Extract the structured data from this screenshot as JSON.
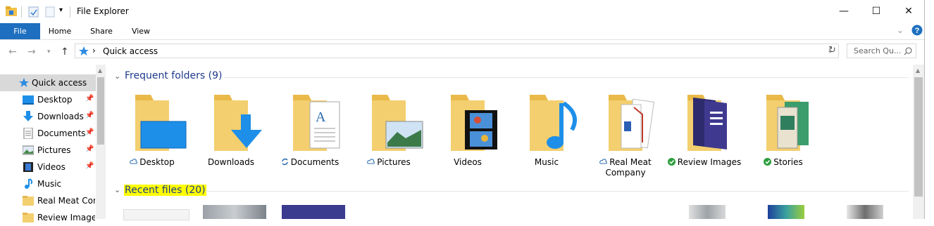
{
  "window": {
    "title": "File Explorer",
    "minimize": "—",
    "maximize": "☐",
    "close": "✕"
  },
  "ribbon": {
    "tabs": [
      "File",
      "Home",
      "Share",
      "View"
    ]
  },
  "address": {
    "location": "Quick access",
    "separator": "›",
    "search_placeholder": "Search Qu..."
  },
  "sidebar": {
    "items": [
      {
        "label": "Quick access",
        "pinned": false,
        "selected": true
      },
      {
        "label": "Desktop",
        "pinned": true
      },
      {
        "label": "Downloads",
        "pinned": true
      },
      {
        "label": "Documents",
        "pinned": true
      },
      {
        "label": "Pictures",
        "pinned": true
      },
      {
        "label": "Videos",
        "pinned": true
      },
      {
        "label": "Music",
        "pinned": false
      },
      {
        "label": "Real Meat Com",
        "pinned": false
      },
      {
        "label": "Review Images",
        "pinned": false
      }
    ]
  },
  "frequent": {
    "title": "Frequent folders (9)",
    "folders": [
      {
        "label": "Desktop",
        "status": "cloud"
      },
      {
        "label": "Downloads",
        "status": ""
      },
      {
        "label": "Documents",
        "status": "sync"
      },
      {
        "label": "Pictures",
        "status": "cloud"
      },
      {
        "label": "Videos",
        "status": ""
      },
      {
        "label": "Music",
        "status": ""
      },
      {
        "label": "Real Meat Company",
        "status": "cloud"
      },
      {
        "label": "Review Images",
        "status": "ok"
      },
      {
        "label": "Stories",
        "status": "ok"
      }
    ]
  },
  "recent": {
    "title": "Recent files (20)"
  },
  "colors": {
    "accent": "#1e6fbf",
    "folder": "#f3cf6f",
    "highlight": "#ffff00"
  }
}
